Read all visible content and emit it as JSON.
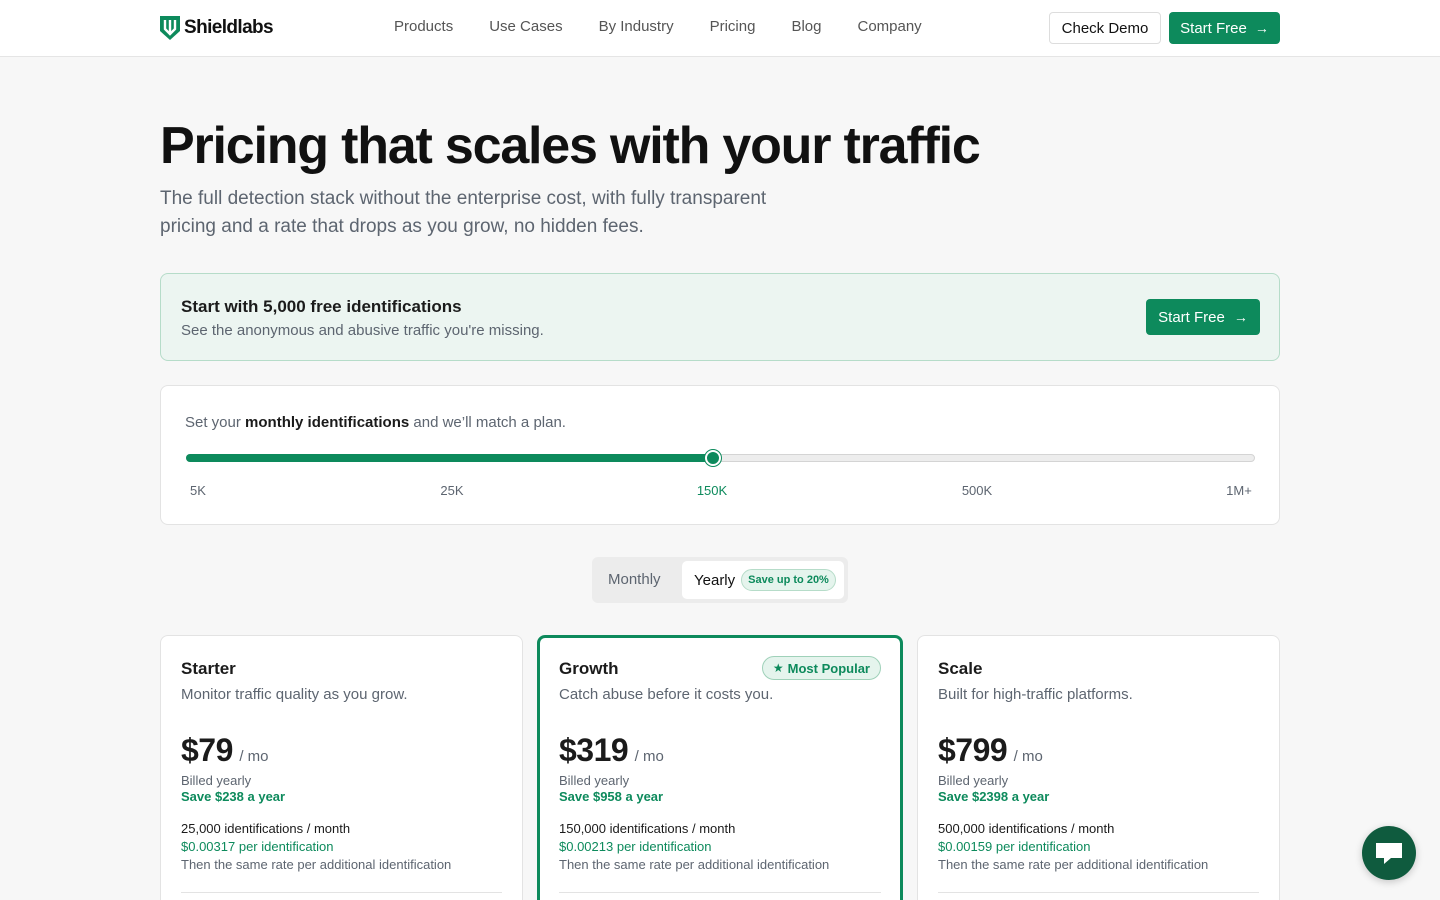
{
  "brand": {
    "name": "Shieldlabs",
    "accent": "#0d8a5c"
  },
  "nav": {
    "items": [
      {
        "label": "Products"
      },
      {
        "label": "Use Cases"
      },
      {
        "label": "By Industry"
      },
      {
        "label": "Pricing"
      },
      {
        "label": "Blog"
      },
      {
        "label": "Company"
      }
    ],
    "demo_label": "Check Demo",
    "start_label": "Start Free"
  },
  "hero": {
    "title": "Pricing that scales with your traffic",
    "subtitle": "The full detection stack without the enterprise cost, with fully transparent pricing and a rate that drops as you grow, no hidden fees."
  },
  "banner": {
    "title": "Start with 5,000 free identifications",
    "subtitle": "See the anonymous and abusive traffic you're missing.",
    "button_label": "Start Free"
  },
  "slider": {
    "label_prefix": "Set your ",
    "label_bold": "monthly identifications",
    "label_suffix": " and we’ll match a plan.",
    "ticks": [
      "5K",
      "25K",
      "150K",
      "500K",
      "1M+"
    ],
    "selected": "150K",
    "selected_index": 2
  },
  "billing": {
    "monthly_label": "Monthly",
    "yearly_label": "Yearly",
    "save_badge": "Save up to 20%",
    "active": "Yearly"
  },
  "plans": [
    {
      "name": "Starter",
      "description": "Monitor traffic quality as you grow.",
      "price": "$79",
      "unit": "/ mo",
      "billed": "Billed yearly",
      "savings": "Save $238 a year",
      "identifications": "25,000 identifications / month",
      "rate": "$0.00317 per identification",
      "rate_note": "Then the same rate per additional identification"
    },
    {
      "name": "Growth",
      "description": "Catch abuse before it costs you.",
      "price": "$319",
      "unit": "/ mo",
      "billed": "Billed yearly",
      "savings": "Save $958 a year",
      "identifications": "150,000 identifications / month",
      "rate": "$0.00213 per identification",
      "rate_note": "Then the same rate per additional identification",
      "badge": "Most Popular"
    },
    {
      "name": "Scale",
      "description": "Built for high-traffic platforms.",
      "price": "$799",
      "unit": "/ mo",
      "billed": "Billed yearly",
      "savings": "Save $2398 a year",
      "identifications": "500,000 identifications / month",
      "rate": "$0.00159 per identification",
      "rate_note": "Then the same rate per additional identification"
    }
  ],
  "icons": {
    "arrow": "arrow-right-icon",
    "star": "star-icon",
    "chat": "chat-icon"
  }
}
